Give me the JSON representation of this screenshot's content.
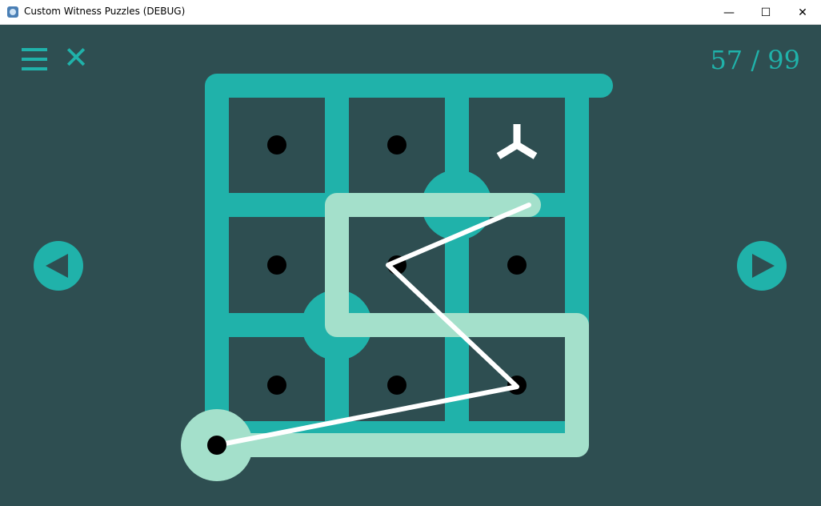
{
  "window": {
    "title": "Custom Witness Puzzles (DEBUG)",
    "minimize_glyph": "—",
    "maximize_glyph": "☐",
    "close_glyph": "✕"
  },
  "toolbar": {
    "menu_icon": "hamburger-menu-icon",
    "close_icon": "close-icon",
    "close_glyph": "✕"
  },
  "level": {
    "current": "57",
    "separator": " / ",
    "total": "99"
  },
  "navigation": {
    "prev_icon": "triangle-left-icon",
    "next_icon": "triangle-right-icon"
  },
  "puzzle": {
    "grid_cols": 3,
    "grid_rows": 3,
    "colors": {
      "background": "#2e4e51",
      "line": "#20b2aa",
      "path": "#a4e0cb",
      "trace": "#ffffff",
      "dot": "#000000"
    },
    "dot_cells": [
      [
        0,
        0
      ],
      [
        1,
        0
      ],
      [
        0,
        1
      ],
      [
        1,
        1
      ],
      [
        2,
        1
      ],
      [
        0,
        2
      ],
      [
        1,
        2
      ],
      [
        2,
        2
      ]
    ],
    "symbol": {
      "type": "y-shape",
      "cell": [
        2,
        0
      ],
      "color": "#ffffff"
    }
  }
}
